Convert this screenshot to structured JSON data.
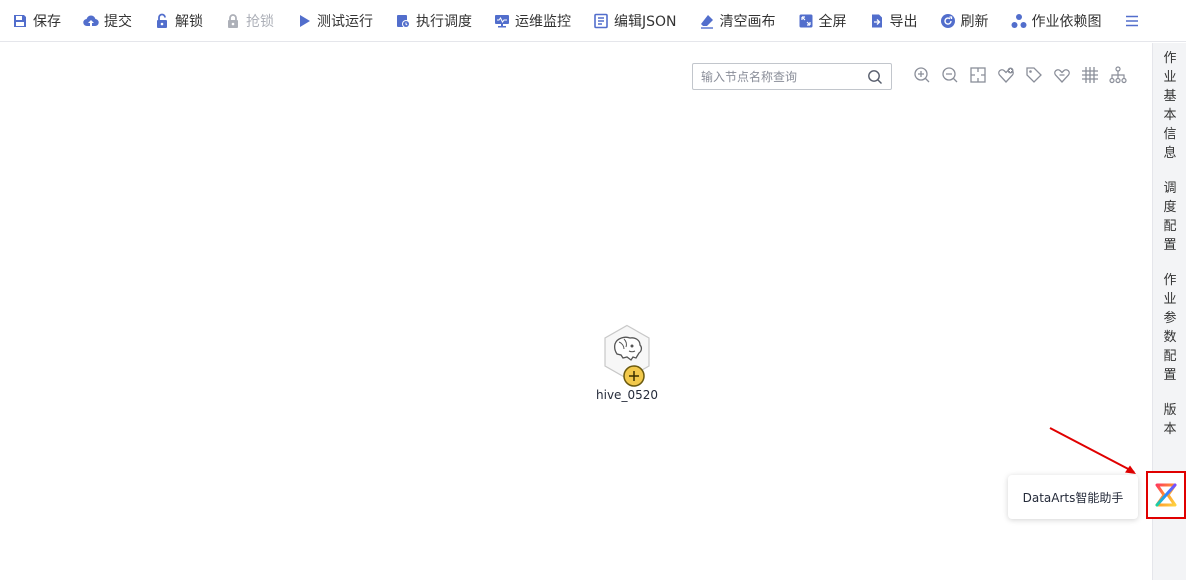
{
  "toolbar": {
    "items": [
      {
        "label": "保存",
        "icon": "save-icon",
        "disabled": false
      },
      {
        "label": "提交",
        "icon": "cloud-upload-icon",
        "disabled": false
      },
      {
        "label": "解锁",
        "icon": "unlock-icon",
        "disabled": false
      },
      {
        "label": "抢锁",
        "icon": "lock-icon",
        "disabled": true
      },
      {
        "label": "测试运行",
        "icon": "play-icon",
        "disabled": false
      },
      {
        "label": "执行调度",
        "icon": "schedule-icon",
        "disabled": false
      },
      {
        "label": "运维监控",
        "icon": "monitor-icon",
        "disabled": false
      },
      {
        "label": "编辑JSON",
        "icon": "json-icon",
        "disabled": false
      },
      {
        "label": "清空画布",
        "icon": "eraser-icon",
        "disabled": false
      },
      {
        "label": "全屏",
        "icon": "fullscreen-icon",
        "disabled": false
      },
      {
        "label": "导出",
        "icon": "export-icon",
        "disabled": false
      },
      {
        "label": "刷新",
        "icon": "refresh-icon",
        "disabled": false
      },
      {
        "label": "作业依赖图",
        "icon": "dependency-graph-icon",
        "disabled": false
      }
    ],
    "menu_icon": "hamburger-menu-icon"
  },
  "canvas": {
    "search": {
      "placeholder": "输入节点名称查询",
      "value": ""
    },
    "tools": [
      "zoom-in-icon",
      "zoom-out-icon",
      "fit-view-icon",
      "add-tag-icon",
      "tag-icon",
      "remove-tag-icon",
      "grid-icon",
      "layout-icon"
    ],
    "node": {
      "name": "hive_0520",
      "icon": "hive-icon",
      "status_icon": "add-circle-icon"
    }
  },
  "side_panel": {
    "tabs": [
      {
        "label": "作业基本信息"
      },
      {
        "label": "调度配置"
      },
      {
        "label": "作业参数配置"
      },
      {
        "label": "版本"
      }
    ]
  },
  "assistant": {
    "tooltip": "DataArts智能助手",
    "icon": "dataarts-assistant-icon"
  },
  "colors": {
    "primary": "#526ecc",
    "disabled": "#adb0b8",
    "highlight": "#e00000",
    "node_badge": "#f2c94c"
  }
}
